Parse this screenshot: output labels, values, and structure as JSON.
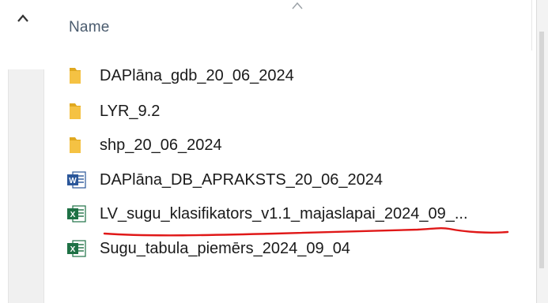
{
  "header": {
    "column_name": "Name",
    "sort_icon": "chevron-up-icon",
    "scroll_up_icon": "chevron-up-icon"
  },
  "files": [
    {
      "name": "DAPlāna_gdb_20_06_2024",
      "type": "folder",
      "icon": "folder-icon"
    },
    {
      "name": "LYR_9.2",
      "type": "folder",
      "icon": "folder-icon"
    },
    {
      "name": "shp_20_06_2024",
      "type": "folder",
      "icon": "folder-icon"
    },
    {
      "name": "DAPlāna_DB_APRAKSTS_20_06_2024",
      "type": "word",
      "icon": "word-document-icon"
    },
    {
      "name": "LV_sugu_klasifikators_v1.1_majaslapai_2024_09_...",
      "type": "excel",
      "icon": "excel-document-icon"
    },
    {
      "name": "Sugu_tabula_piemērs_2024_09_04",
      "type": "excel",
      "icon": "excel-document-icon"
    }
  ],
  "colors": {
    "folder": "#f5c243",
    "folder_dark": "#e0a81f",
    "word": "#2b579a",
    "excel": "#1e7145",
    "annotation": "#e01818",
    "header_text": "#4a5b6e"
  }
}
